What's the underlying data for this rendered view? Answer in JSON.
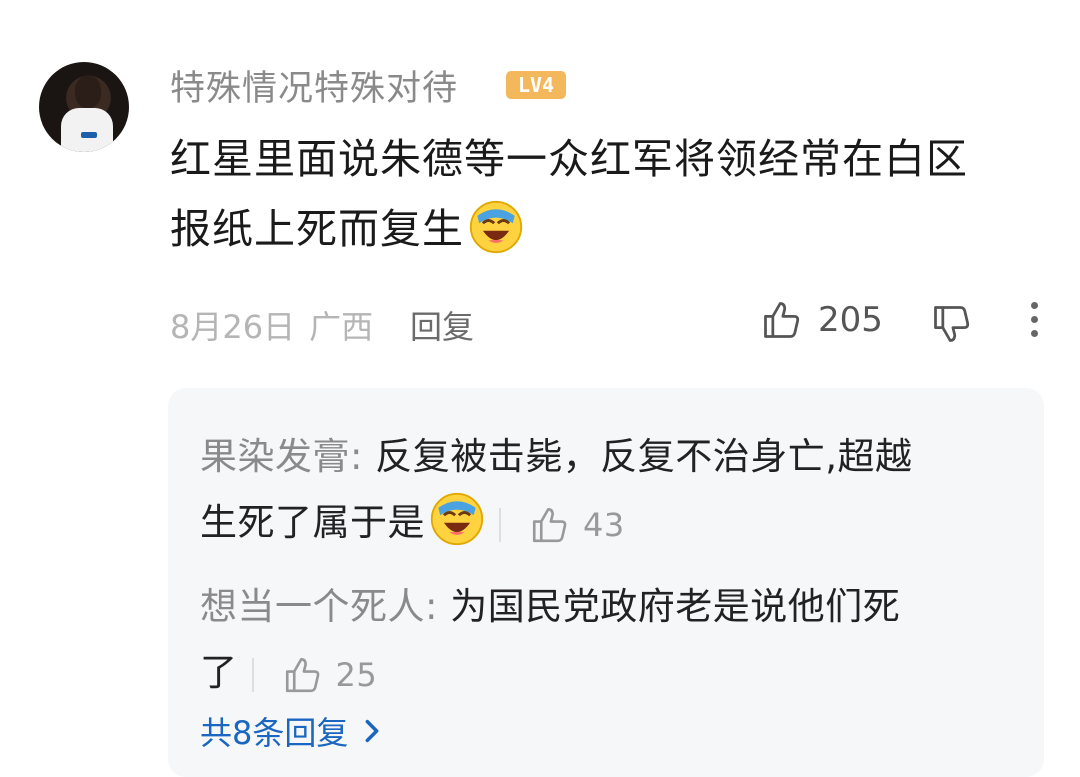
{
  "comment": {
    "username": "特殊情况特殊对待",
    "level_badge": "LV4",
    "text_line1": "红星里面说朱德等一众红军将领经常在白区",
    "text_line2": "报纸上死而复生",
    "emoji": "laughing-crying-emoji",
    "date": "8月26日",
    "region": "广西",
    "reply_label": "回复",
    "like_count": "205",
    "accent_color": "#1a66c0",
    "badge_color": "#f4b85c"
  },
  "replies": [
    {
      "author": "果染发膏:",
      "text_line1": " 反复被击毙，反复不治身亡,超越",
      "text_line2": "生死了属于是",
      "emoji": "laughing-crying-emoji",
      "like_count": "43"
    },
    {
      "author": "想当一个死人:",
      "text_line1": " 为国民党政府老是说他们死",
      "text_line2": "了",
      "like_count": "25"
    }
  ],
  "view_all_label": "共8条回复"
}
